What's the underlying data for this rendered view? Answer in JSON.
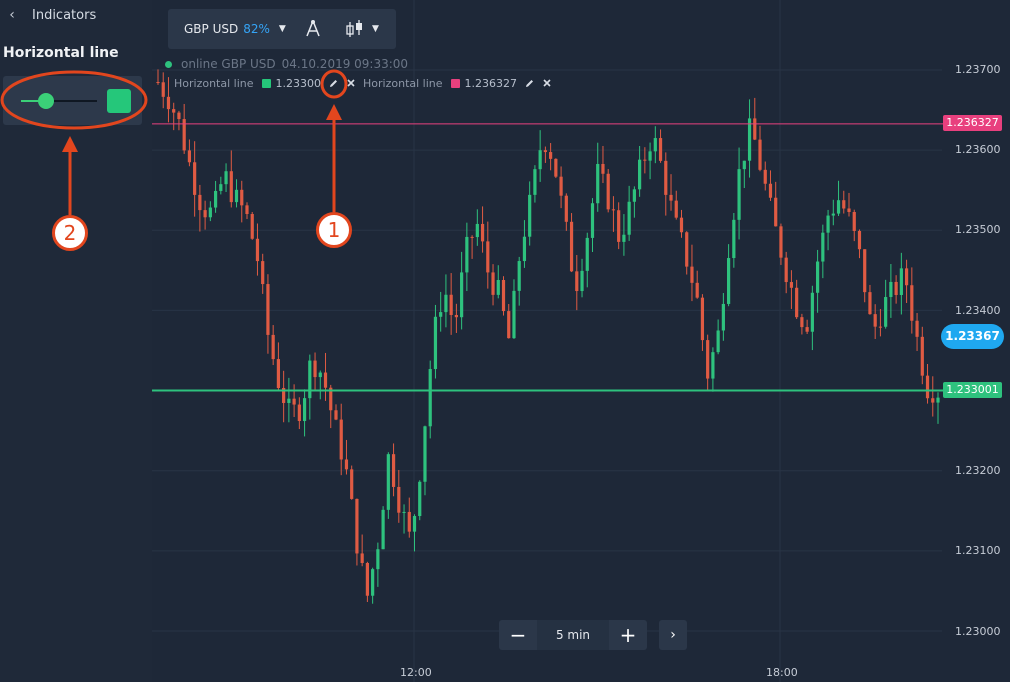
{
  "sidebar": {
    "back_icon": "chevron-left-icon",
    "title": "Indicators",
    "heading": "Horizontal line",
    "slider": {
      "value": 0.35,
      "color": "#3bd078"
    },
    "swatch_color": "#25c77a"
  },
  "toolbar": {
    "asset": "GBP USD",
    "payout": "82%",
    "draw_icon": "drawing-tools-icon",
    "chart_type_icon": "candlestick-icon"
  },
  "status": {
    "online_text": "online GBP USD",
    "datetime": "04.10.2019 09:33:00"
  },
  "legend": [
    {
      "name": "Horizontal line",
      "value": "1.23300",
      "color": "#25c77a"
    },
    {
      "name": "Horizontal line",
      "value": "1.236327",
      "color": "#e8407e"
    }
  ],
  "price_axis": [
    "1.23700",
    "1.23600",
    "1.23500",
    "1.23400",
    "1.23200",
    "1.23100",
    "1.23000"
  ],
  "horizontal_lines": [
    {
      "label": "1.236327",
      "value": 1.236327,
      "color": "#e8407e"
    },
    {
      "label": "1.233001",
      "value": 1.233001,
      "color": "#2ec27e"
    }
  ],
  "current_price": "1.23367",
  "time_axis": [
    "12:00",
    "18:00"
  ],
  "timeframe": {
    "minus": "−",
    "value": "5 min",
    "plus": "+",
    "next": "›"
  },
  "annotations": [
    {
      "number": "1"
    },
    {
      "number": "2"
    }
  ],
  "chart_data": {
    "type": "candlestick",
    "ylim": [
      1.2296,
      1.2376
    ],
    "up_color": "#2ec27e",
    "down_color": "#e05b43",
    "close_trace": [
      1.23685,
      1.23665,
      1.2363,
      1.23575,
      1.2353,
      1.2352,
      1.2357,
      1.2354,
      1.2352,
      1.2347,
      1.2337,
      1.2331,
      1.2327,
      1.2328,
      1.2334,
      1.2332,
      1.2326,
      1.2321,
      1.2312,
      1.2304,
      1.2311,
      1.2322,
      1.2316,
      1.2311,
      1.2322,
      1.2336,
      1.2343,
      1.2338,
      1.2347,
      1.2351,
      1.2345,
      1.2342,
      1.2336,
      1.2348,
      1.2354,
      1.2362,
      1.2359,
      1.2351,
      1.2343,
      1.2349,
      1.2357,
      1.2354,
      1.2349,
      1.2353,
      1.2358,
      1.2362,
      1.2357,
      1.2351,
      1.2347,
      1.2342,
      1.2332,
      1.2337,
      1.2349,
      1.2358,
      1.2363,
      1.2357,
      1.2351,
      1.2346,
      1.2341,
      1.2338,
      1.2346,
      1.2352,
      1.2354,
      1.2351,
      1.2346,
      1.2337,
      1.23405,
      1.23425,
      1.23445,
      1.2337,
      1.23305,
      1.233
    ]
  }
}
